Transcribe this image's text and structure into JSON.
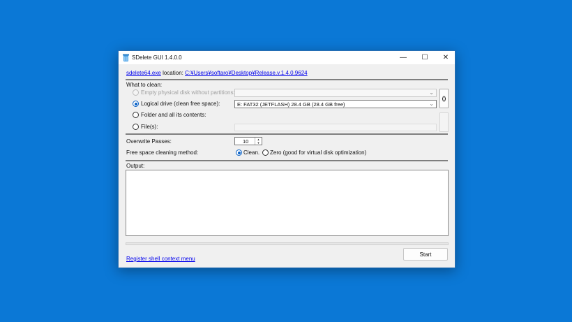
{
  "window": {
    "title": "SDelete GUI 1.4.0.0",
    "minimize_glyph": "—",
    "maximize_glyph": "☐",
    "close_glyph": "✕"
  },
  "location": {
    "exe_link": "sdelete64.exe",
    "label": "location:",
    "path_link": "C:¥Users¥softaro¥Desktop¥Release.v.1.4.0.9624"
  },
  "clean": {
    "heading": "What to clean:",
    "options": [
      {
        "label": "Empty physical disk without partitions:",
        "checked": false,
        "enabled": false
      },
      {
        "label": "Logical drive (clean free space):",
        "checked": true,
        "enabled": true
      },
      {
        "label": "Folder and all its contents:",
        "checked": false,
        "enabled": true
      },
      {
        "label": "File(s):",
        "checked": false,
        "enabled": true
      }
    ],
    "drive_value": "E: FAT32 (JETFLASH) 28.4 GB (28.4 GB free)",
    "refresh_label": "⟨⟩"
  },
  "passes": {
    "label": "Overwrite Passes:",
    "value": "10"
  },
  "method": {
    "label": "Free space cleaning method:",
    "options": [
      {
        "label": "Clean.",
        "checked": true
      },
      {
        "label": "Zero (good for virtual disk optimization)",
        "checked": false
      }
    ]
  },
  "output": {
    "label": "Output:"
  },
  "progress": {
    "fraction": 0
  },
  "footer": {
    "register_link": "Register shell context menu",
    "start_label": "Start"
  },
  "colors": {
    "desktop": "#0b78d6",
    "accent": "#0b62c6",
    "link": "#0000ee"
  },
  "icons": {
    "app": "sdelete-app-icon",
    "dropdown": "chevron-down-icon",
    "refresh": "refresh-icon"
  }
}
